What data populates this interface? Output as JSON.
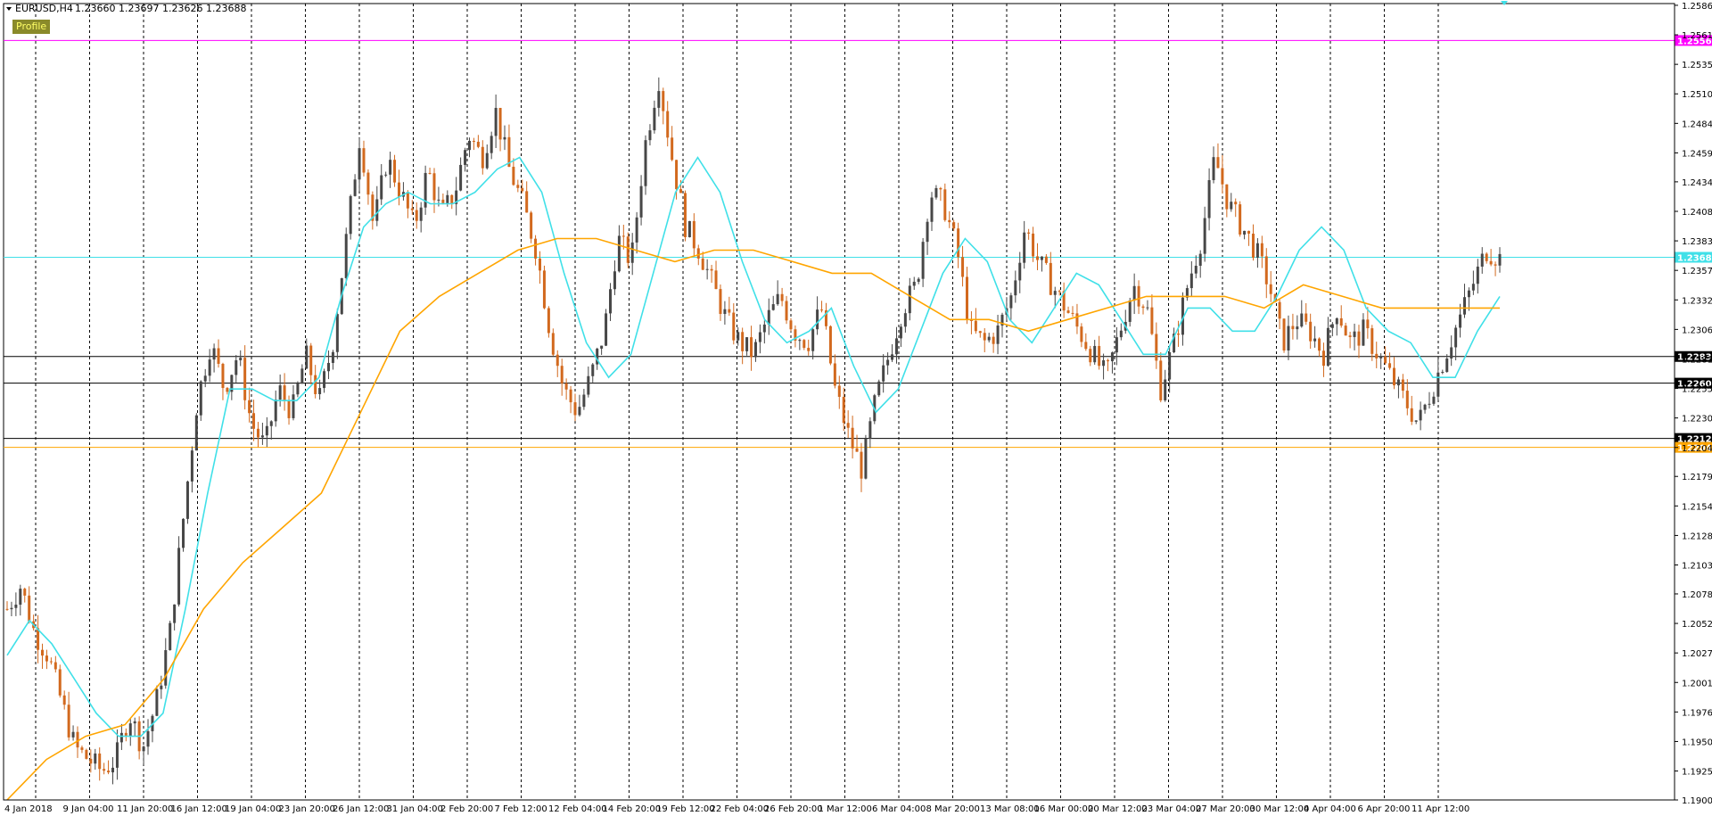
{
  "header": {
    "symbol": "EURUSD,H4",
    "ohlc": "1.23660 1.23697 1.23626 1.23688",
    "profile_label": "Profile"
  },
  "colors": {
    "bull": "#474747",
    "bear": "#d2691e",
    "ma_fast": "#40e0e8",
    "ma_slow": "#ffa500",
    "level_magenta": "#ff00ff",
    "level_cyan": "#40e0e8",
    "level_black": "#000000",
    "level_orange": "#ffa500",
    "grid": "#000000"
  },
  "chart_data": {
    "type": "line",
    "title": "",
    "ylim": [
      1.19,
      1.2588
    ],
    "grid": "vertical-dotted",
    "y_ticks": [
      "1.25865",
      "1.25610",
      "1.25355",
      "1.25100",
      "1.24845",
      "1.24590",
      "1.24340",
      "1.24085",
      "1.23830",
      "1.23575",
      "1.23320",
      "1.23065",
      "1.22810",
      "1.22555",
      "1.22300",
      "1.22045",
      "1.21795",
      "1.21540",
      "1.21285",
      "1.21030",
      "1.20780",
      "1.20525",
      "1.20270",
      "1.20015",
      "1.19760",
      "1.19505",
      "1.19250",
      "1.19000"
    ],
    "x_ticks": [
      "4 Jan 2018",
      "9 Jan 04:00",
      "11 Jan 20:00",
      "16 Jan 12:00",
      "19 Jan 04:00",
      "23 Jan 20:00",
      "26 Jan 12:00",
      "31 Jan 04:00",
      "2 Feb 20:00",
      "7 Feb 12:00",
      "12 Feb 04:00",
      "14 Feb 20:00",
      "19 Feb 12:00",
      "22 Feb 04:00",
      "26 Feb 20:00",
      "1 Mar 12:00",
      "6 Mar 04:00",
      "8 Mar 20:00",
      "13 Mar 08:00",
      "16 Mar 00:00",
      "20 Mar 12:00",
      "23 Mar 04:00",
      "27 Mar 20:00",
      "30 Mar 12:00",
      "4 Apr 04:00",
      "6 Apr 20:00",
      "11 Apr 12:00"
    ],
    "levels": [
      {
        "value": 1.25561,
        "label": "1.25561",
        "color": "magenta"
      },
      {
        "value": 1.23688,
        "label": "1.23688",
        "color": "cyan"
      },
      {
        "value": 1.22831,
        "label": "1.22831",
        "color": "black"
      },
      {
        "value": 1.22601,
        "label": "1.22601",
        "color": "black"
      },
      {
        "value": 1.22123,
        "label": "1.22123",
        "color": "black"
      },
      {
        "value": 1.22046,
        "label": "1.22046",
        "color": "orange"
      }
    ],
    "price_path": [
      1.2065,
      1.2085,
      1.2045,
      1.2025,
      1.1985,
      1.1945,
      1.1935,
      1.1925,
      1.1935,
      1.1975,
      1.1945,
      1.1985,
      1.2045,
      1.2145,
      1.2245,
      1.2295,
      1.2255,
      1.2285,
      1.2225,
      1.2205,
      1.2255,
      1.2235,
      1.2285,
      1.2245,
      1.2295,
      1.2385,
      1.2475,
      1.2395,
      1.2455,
      1.2425,
      1.2395,
      1.2445,
      1.2405,
      1.2425,
      1.2475,
      1.2455,
      1.2495,
      1.2445,
      1.2415,
      1.2375,
      1.2305,
      1.2255,
      1.2235,
      1.2265,
      1.2305,
      1.2385,
      1.2365,
      1.2465,
      1.2525,
      1.2455,
      1.2395,
      1.2375,
      1.2345,
      1.2315,
      1.2295,
      1.2285,
      1.2315,
      1.2335,
      1.2305,
      1.2295,
      1.2325,
      1.2255,
      1.2215,
      1.2185,
      1.2245,
      1.2285,
      1.2325,
      1.2345,
      1.2425,
      1.2415,
      1.2375,
      1.2305,
      1.2295,
      1.2305,
      1.2335,
      1.2395,
      1.2365,
      1.2345,
      1.2325,
      1.2305,
      1.2285,
      1.2265,
      1.2305,
      1.2345,
      1.2325,
      1.2255,
      1.2295,
      1.2345,
      1.2385,
      1.2455,
      1.2415,
      1.2395,
      1.2375,
      1.2345,
      1.2295,
      1.2315,
      1.2305,
      1.2285,
      1.2325,
      1.2295,
      1.2305,
      1.2285,
      1.2265,
      1.2245,
      1.2225,
      1.2255,
      1.2285,
      1.2315,
      1.2345,
      1.2375,
      1.2368
    ],
    "series": [
      {
        "type": "line",
        "color": "ma_fast",
        "values": [
          1.2025,
          1.2055,
          1.2035,
          1.2005,
          1.1975,
          1.1955,
          1.1955,
          1.1975,
          1.2065,
          1.2165,
          1.2255,
          1.2255,
          1.2245,
          1.2245,
          1.2265,
          1.2335,
          1.2395,
          1.2415,
          1.2425,
          1.2415,
          1.2415,
          1.2425,
          1.2445,
          1.2455,
          1.2425,
          1.2355,
          1.2295,
          1.2265,
          1.2285,
          1.2355,
          1.2425,
          1.2455,
          1.2425,
          1.2365,
          1.2315,
          1.2295,
          1.2305,
          1.2325,
          1.2275,
          1.2235,
          1.2255,
          1.2305,
          1.2355,
          1.2385,
          1.2365,
          1.2315,
          1.2295,
          1.2325,
          1.2355,
          1.2345,
          1.2315,
          1.2285,
          1.2285,
          1.2325,
          1.2325,
          1.2305,
          1.2305,
          1.2335,
          1.2375,
          1.2395,
          1.2375,
          1.2325,
          1.2305,
          1.2295,
          1.2265,
          1.2265,
          1.2305,
          1.2335
        ]
      },
      {
        "type": "line",
        "color": "ma_slow",
        "values": [
          1.19,
          1.1935,
          1.1955,
          1.1965,
          1.2005,
          1.2065,
          1.2105,
          1.2135,
          1.2165,
          1.2235,
          1.2305,
          1.2335,
          1.2355,
          1.2375,
          1.2385,
          1.2385,
          1.2375,
          1.2365,
          1.2375,
          1.2375,
          1.2365,
          1.2355,
          1.2355,
          1.2335,
          1.2315,
          1.2315,
          1.2305,
          1.2315,
          1.2325,
          1.2335,
          1.2335,
          1.2335,
          1.2325,
          1.2345,
          1.2335,
          1.2325,
          1.2325,
          1.2325,
          1.2325
        ]
      }
    ]
  }
}
